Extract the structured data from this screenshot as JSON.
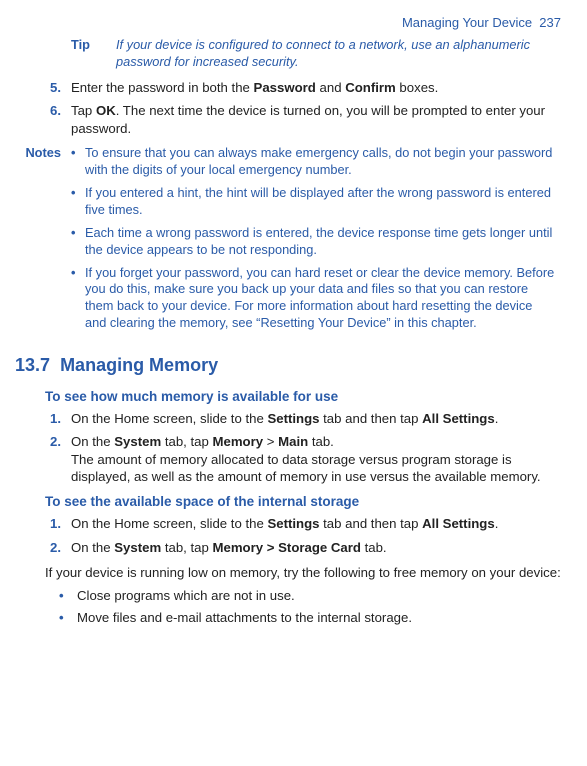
{
  "header": {
    "title": "Managing Your Device",
    "page": "237"
  },
  "tip": {
    "label": "Tip",
    "text": "If your device is configured to connect to a network, use an alphanumeric password for increased security."
  },
  "steps_top": [
    {
      "n": "5.",
      "pre": "Enter the password in both the ",
      "b1": "Password",
      "mid": " and ",
      "b2": "Confirm",
      "post": " boxes."
    },
    {
      "n": "6.",
      "pre": "Tap ",
      "b1": "OK",
      "post": ". The next time the device is turned on, you will be prompted to enter your password."
    }
  ],
  "notes": {
    "label": "Notes",
    "items": [
      "To ensure that you can always make emergency calls, do not begin your password with the digits of your local emergency number.",
      "If you entered a hint, the hint will be displayed after the wrong password is entered five times.",
      "Each time a wrong password is entered, the device response time gets longer until the device appears to be not responding.",
      "If you forget your password, you can hard reset or clear the device memory. Before you do this, make sure you back up your data and files so that you can restore them back to your device. For more information about hard resetting the device and clearing the memory, see “Resetting Your Device” in this chapter."
    ]
  },
  "section": {
    "num": "13.7",
    "title": "Managing Memory"
  },
  "sub1": {
    "title": "To see how much memory is available for use",
    "steps": [
      {
        "n": "1.",
        "pre": "On the Home screen, slide to the ",
        "b1": "Settings",
        "mid": " tab and then tap ",
        "b2": "All Settings",
        "post": "."
      },
      {
        "n": "2.",
        "pre": "On the ",
        "b1": "System",
        "mid": " tab, tap ",
        "b2": "Memory",
        "mid2": " > ",
        "b3": "Main",
        "post2": " tab.",
        "extra": "The amount of memory allocated to data storage versus program storage is displayed, as well as the amount of memory in use versus the available memory."
      }
    ]
  },
  "sub2": {
    "title": "To see the available space of the internal storage",
    "steps": [
      {
        "n": "1.",
        "pre": "On the Home screen, slide to the ",
        "b1": "Settings",
        "mid": " tab and then tap ",
        "b2": "All Settings",
        "post": "."
      },
      {
        "n": "2.",
        "pre": "On the ",
        "b1": "System",
        "mid": " tab, tap ",
        "b2": "Memory >",
        "mid2": " ",
        "b3": "Storage Card",
        "post2": " tab."
      }
    ]
  },
  "para_low": "If your device is running low on memory, try the following to free memory on your device:",
  "bullets": [
    "Close programs which are not in use.",
    "Move files and e-mail attachments to the internal storage."
  ]
}
